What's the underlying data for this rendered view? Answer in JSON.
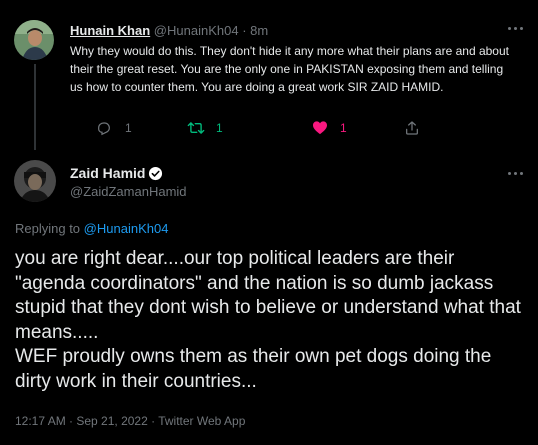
{
  "reply_tweet": {
    "author_name": "Hunain Khan",
    "author_handle": "@HunainKh04",
    "separator": "·",
    "time_ago": "8m",
    "text": "Why they would do this. They don't hide it any more what their plans are and about their the great reset. You are the only one in PAKISTAN exposing them and telling us how to counter them. You are doing a great work SIR ZAID HAMID.",
    "actions": {
      "reply_count": "1",
      "retweet_count": "1",
      "like_count": "1"
    },
    "colors": {
      "retweet": "#00ba7c",
      "like": "#f91880"
    }
  },
  "main_tweet": {
    "author_name": "Zaid Hamid",
    "author_handle": "@ZaidZamanHamid",
    "replying_prefix": "Replying to",
    "replying_handle": "@HunainKh04",
    "text": "you are right dear....our top political leaders are their \"agenda coordinators\" and the nation is so dumb jackass stupid that they dont wish to believe or understand what that means.....\nWEF proudly owns them as their own pet dogs doing the dirty work in their countries...",
    "timestamp": "12:17 AM · Sep 21, 2022 · Twitter Web App"
  },
  "icons": [
    "more-icon",
    "reply-icon",
    "retweet-icon",
    "like-icon",
    "share-icon",
    "verified-badge-icon"
  ]
}
